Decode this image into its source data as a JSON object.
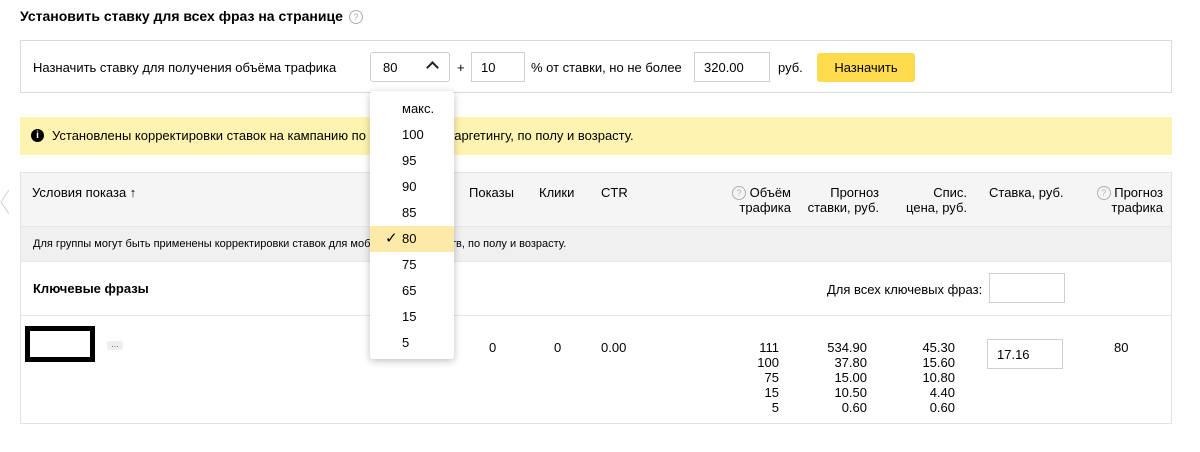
{
  "page_title": "Установить ставку для всех фраз на странице",
  "help_glyph": "?",
  "bid_form": {
    "label": "Назначить ставку для получения объёма трафика",
    "traffic_value": "80",
    "plus": "+",
    "percent_value": "10",
    "percent_label": "% от ставки, но не более",
    "max_value": "320.00",
    "currency": "руб.",
    "assign_button": "Назначить"
  },
  "notice": {
    "icon": "info-icon",
    "text": "Установлены корректировки ставок на кампанию по мобильному таргетингу, по полу и возрасту."
  },
  "table": {
    "headers": {
      "conditions": "Условия показа ↑",
      "shows": "Показы",
      "clicks": "Клики",
      "ctr": "CTR",
      "volume_line1": "Объём",
      "volume_line2": "трафика",
      "forecast_line1": "Прогноз",
      "forecast_line2": "ставки, руб.",
      "list_line1": "Спис.",
      "list_line2": "цена, руб.",
      "bid": "Ставка, руб.",
      "tforecast_line1": "Прогноз",
      "tforecast_line2": "трафика"
    },
    "group_note": "Для группы могут быть применены корректировки ставок для мобильных устройств, по полу и возрасту.",
    "keywords_title": "Ключевые фразы",
    "all_keywords_label": "Для всех ключевых фраз:",
    "row": {
      "more": "...",
      "shows": "0",
      "clicks": "0",
      "ctr": "0.00",
      "volume": [
        "111",
        "100",
        "75",
        "15",
        "5"
      ],
      "forecast_bids": [
        "534.90",
        "37.80",
        "15.00",
        "10.50",
        "0.60"
      ],
      "list_prices": [
        "45.30",
        "15.60",
        "10.80",
        "4.40",
        "0.60"
      ],
      "bid": "17.16",
      "traffic_forecast": "80"
    }
  },
  "dropdown": {
    "options": [
      "макс.",
      "100",
      "95",
      "90",
      "85",
      "80",
      "75",
      "65",
      "15",
      "5"
    ],
    "selected": "80",
    "check_glyph": "✓"
  },
  "colors": {
    "accent_button": "#ffdb4d",
    "notice_bg": "#fef3b0",
    "selected_option": "#fdeaa8"
  }
}
